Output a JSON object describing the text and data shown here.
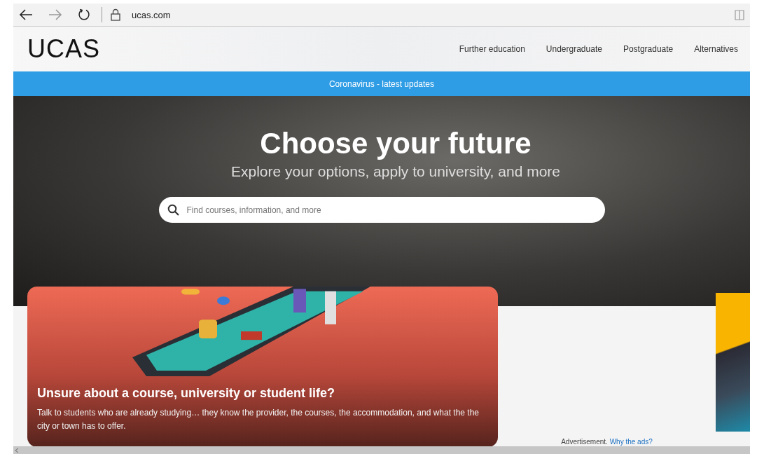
{
  "browser": {
    "url": "ucas.com"
  },
  "header": {
    "logo": "UCAS",
    "nav": [
      {
        "label": "Further education"
      },
      {
        "label": "Undergraduate"
      },
      {
        "label": "Postgraduate"
      },
      {
        "label": "Alternatives"
      }
    ]
  },
  "alert_bar": {
    "text": "Coronavirus - latest updates"
  },
  "hero": {
    "title": "Choose your future",
    "subtitle": "Explore your options, apply to university, and more",
    "search": {
      "placeholder": "Find courses, information, and more"
    }
  },
  "promo_card": {
    "title": "Unsure about a course, university or student life?",
    "body": "Talk to students who are already studying… they know the provider, the courses, the accommodation, and what the the city or town has to offer."
  },
  "advertisement": {
    "label": "Advertisement.",
    "link": "Why the ads?"
  }
}
